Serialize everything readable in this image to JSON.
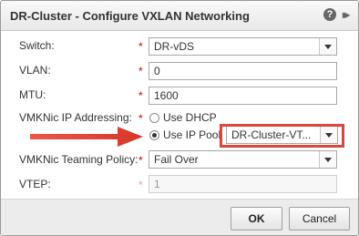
{
  "dialog": {
    "title": "DR-Cluster - Configure VXLAN Networking",
    "help_glyph": "?",
    "expand_glyph": "▸▸"
  },
  "form": {
    "switch": {
      "label": "Switch:",
      "value": "DR-vDS"
    },
    "vlan": {
      "label": "VLAN:",
      "value": "0"
    },
    "mtu": {
      "label": "MTU:",
      "value": "1600"
    },
    "vmknic_ip": {
      "label": "VMKNic IP Addressing:",
      "option_dhcp": "Use DHCP",
      "option_pool": "Use IP Pool",
      "pool_value": "DR-Cluster-VT...",
      "selected": "Use IP Pool"
    },
    "teaming": {
      "label": "VMKNic Teaming Policy:",
      "value": "Fail Over"
    },
    "vtep": {
      "label": "VTEP:",
      "value": "1"
    },
    "required_mark": "*"
  },
  "buttons": {
    "ok": "OK",
    "cancel": "Cancel"
  },
  "colors": {
    "highlight": "#d9473d",
    "required": "#cc0000"
  },
  "icons": {
    "help": "help-icon",
    "expand": "expand-icon",
    "dropdown": "chevron-down-icon",
    "callout": "arrow-right-icon"
  }
}
